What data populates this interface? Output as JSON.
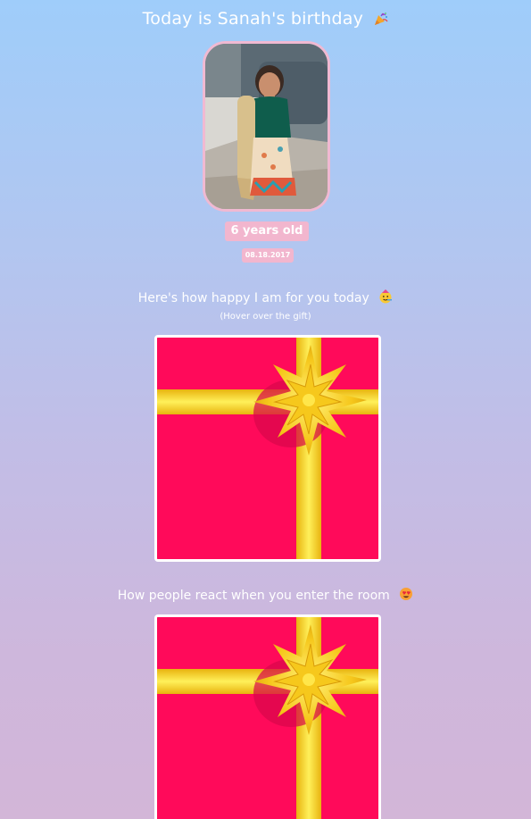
{
  "header": {
    "title": "Today is Sanah's birthday",
    "title_icon": "party-popper-icon"
  },
  "profile": {
    "photo_alt": "Sanah",
    "age_label": "6 years old",
    "date_label": "08.18.2017"
  },
  "section_gift": {
    "heading": "Here's how happy I am for you today",
    "heading_icon": "partying-face-icon",
    "hint": "(Hover over the gift)"
  },
  "section_room": {
    "heading": "How people react when you enter the room",
    "heading_icon": "heart-eyes-face-icon"
  },
  "colors": {
    "background_top": "#9fcdfa",
    "background_bottom": "#d3b6d8",
    "accent_pink": "#f2b6ce",
    "gift_box": "#ff0a5a",
    "ribbon": "#f7d11c"
  }
}
